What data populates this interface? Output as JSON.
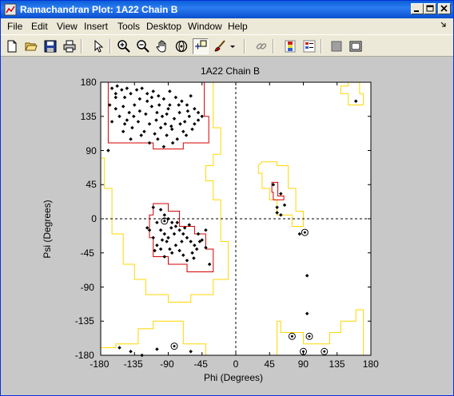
{
  "window": {
    "title": "Ramachandran Plot: 1A22 Chain B"
  },
  "menu": [
    {
      "label": "File"
    },
    {
      "label": "Edit"
    },
    {
      "label": "View"
    },
    {
      "label": "Insert"
    },
    {
      "label": "Tools"
    },
    {
      "label": "Desktop"
    },
    {
      "label": "Window"
    },
    {
      "label": "Help"
    }
  ],
  "toolbar": [
    "new-figure-icon",
    "open-folder-icon",
    "save-icon",
    "print-icon",
    "select-arrow-icon",
    "zoom-in-icon",
    "zoom-out-icon",
    "pan-hand-icon",
    "rotate-3d-icon",
    "data-cursor-icon",
    "brush-icon",
    "link-icon",
    "colorbar-icon",
    "legend-icon",
    "hide-plot-tools-icon",
    "show-plot-tools-icon"
  ],
  "chart_data": {
    "type": "scatter",
    "title": "1A22 Chain B",
    "xlabel": "Phi (Degrees)",
    "ylabel": "Psi (Degrees)",
    "xlim": [
      -180,
      180
    ],
    "ylim": [
      -180,
      180
    ],
    "x_ticks": [
      "-180",
      "-135",
      "-90",
      "-45",
      "0",
      "45",
      "90",
      "135",
      "180"
    ],
    "y_ticks": [
      "180",
      "135",
      "90",
      "45",
      "0",
      "-45",
      "-90",
      "-135",
      "-180"
    ],
    "reference_lines": {
      "phi": 0,
      "psi": 0,
      "style": "dashed"
    },
    "region_colors": {
      "core": "#d40000",
      "allowed": "#ffd700"
    },
    "regions": [
      {
        "name": "core-beta",
        "kind": "core",
        "points": [
          [
            -170,
            180
          ],
          [
            -42,
            180
          ],
          [
            -42,
            135
          ],
          [
            -36,
            135
          ],
          [
            -36,
            100
          ],
          [
            -70,
            100
          ],
          [
            -70,
            92
          ],
          [
            -110,
            92
          ],
          [
            -110,
            100
          ],
          [
            -170,
            100
          ]
        ]
      },
      {
        "name": "core-alpha-right",
        "kind": "core",
        "points": [
          [
            -110,
            20
          ],
          [
            -90,
            20
          ],
          [
            -90,
            10
          ],
          [
            -75,
            10
          ],
          [
            -75,
            -10
          ],
          [
            -55,
            -10
          ],
          [
            -55,
            -20
          ],
          [
            -40,
            -20
          ],
          [
            -40,
            -40
          ],
          [
            -30,
            -40
          ],
          [
            -30,
            -70
          ],
          [
            -65,
            -70
          ],
          [
            -65,
            -60
          ],
          [
            -90,
            -60
          ],
          [
            -90,
            -50
          ],
          [
            -110,
            -50
          ],
          [
            -110,
            -25
          ],
          [
            -115,
            -25
          ],
          [
            -115,
            5
          ],
          [
            -110,
            5
          ]
        ]
      },
      {
        "name": "core-alpha-left",
        "kind": "core",
        "points": [
          [
            48,
            48
          ],
          [
            56,
            48
          ],
          [
            56,
            30
          ],
          [
            64,
            30
          ],
          [
            64,
            25
          ],
          [
            50,
            25
          ],
          [
            50,
            35
          ],
          [
            48,
            35
          ]
        ]
      },
      {
        "name": "allowed-beta",
        "kind": "allowed",
        "points": [
          [
            -180,
            180
          ],
          [
            -30,
            180
          ],
          [
            -30,
            120
          ],
          [
            -20,
            120
          ],
          [
            -20,
            85
          ],
          [
            -30,
            85
          ],
          [
            -30,
            70
          ],
          [
            -40,
            70
          ],
          [
            -40,
            50
          ],
          [
            -30,
            50
          ],
          [
            -30,
            25
          ],
          [
            -20,
            25
          ],
          [
            -20,
            -30
          ],
          [
            -10,
            -30
          ],
          [
            -10,
            -80
          ],
          [
            -30,
            -80
          ],
          [
            -30,
            -100
          ],
          [
            -60,
            -100
          ],
          [
            -60,
            -110
          ],
          [
            -90,
            -110
          ],
          [
            -90,
            -100
          ],
          [
            -120,
            -100
          ],
          [
            -120,
            -80
          ],
          [
            -135,
            -80
          ],
          [
            -135,
            -60
          ],
          [
            -150,
            -60
          ],
          [
            -150,
            -20
          ],
          [
            -165,
            -20
          ],
          [
            -165,
            40
          ],
          [
            -175,
            40
          ],
          [
            -175,
            80
          ],
          [
            -180,
            80
          ]
        ]
      },
      {
        "name": "allowed-alpha-left",
        "kind": "allowed",
        "points": [
          [
            35,
            75
          ],
          [
            55,
            75
          ],
          [
            55,
            70
          ],
          [
            70,
            70
          ],
          [
            70,
            40
          ],
          [
            80,
            40
          ],
          [
            80,
            10
          ],
          [
            90,
            10
          ],
          [
            90,
            -10
          ],
          [
            75,
            -10
          ],
          [
            75,
            5
          ],
          [
            55,
            5
          ],
          [
            55,
            25
          ],
          [
            45,
            25
          ],
          [
            45,
            40
          ],
          [
            35,
            40
          ],
          [
            35,
            60
          ],
          [
            30,
            60
          ],
          [
            30,
            70
          ]
        ]
      },
      {
        "name": "allowed-gamma-bottom",
        "kind": "allowed",
        "points": [
          [
            20,
            -180
          ],
          [
            170,
            -180
          ],
          [
            170,
            -120
          ],
          [
            160,
            -120
          ],
          [
            160,
            -135
          ],
          [
            140,
            -135
          ],
          [
            140,
            -150
          ],
          [
            125,
            -150
          ],
          [
            125,
            -165
          ],
          [
            90,
            -165
          ],
          [
            90,
            -150
          ],
          [
            60,
            -150
          ],
          [
            60,
            -135
          ],
          [
            55,
            -135
          ],
          [
            55,
            -180
          ]
        ]
      },
      {
        "name": "allowed-beta-bottom",
        "kind": "allowed",
        "points": [
          [
            -180,
            -180
          ],
          [
            -40,
            -180
          ],
          [
            -40,
            -165
          ],
          [
            -70,
            -165
          ],
          [
            -70,
            -135
          ],
          [
            -110,
            -135
          ],
          [
            -110,
            -145
          ],
          [
            -130,
            -145
          ],
          [
            -130,
            -165
          ],
          [
            -160,
            -165
          ],
          [
            -160,
            -170
          ],
          [
            -180,
            -170
          ]
        ]
      },
      {
        "name": "allowed-top-right",
        "kind": "allowed",
        "points": [
          [
            150,
            180
          ],
          [
            165,
            180
          ],
          [
            165,
            165
          ],
          [
            170,
            165
          ],
          [
            170,
            150
          ],
          [
            150,
            150
          ],
          [
            150,
            165
          ],
          [
            140,
            165
          ],
          [
            140,
            175
          ],
          [
            150,
            175
          ]
        ]
      }
    ],
    "series": [
      {
        "marker": "dot",
        "points": [
          [
            -165,
            172
          ],
          [
            -158,
            175
          ],
          [
            -152,
            170
          ],
          [
            -160,
            160
          ],
          [
            -148,
            160
          ],
          [
            -140,
            165
          ],
          [
            -132,
            170
          ],
          [
            -125,
            172
          ],
          [
            -118,
            165
          ],
          [
            -110,
            168
          ],
          [
            -103,
            162
          ],
          [
            -96,
            158
          ],
          [
            -88,
            168
          ],
          [
            -80,
            160
          ],
          [
            -72,
            155
          ],
          [
            -65,
            150
          ],
          [
            -60,
            162
          ],
          [
            -55,
            145
          ],
          [
            -50,
            140
          ],
          [
            -45,
            135
          ],
          [
            -168,
            150
          ],
          [
            -160,
            145
          ],
          [
            -150,
            148
          ],
          [
            -142,
            140
          ],
          [
            -135,
            150
          ],
          [
            -128,
            142
          ],
          [
            -120,
            138
          ],
          [
            -112,
            148
          ],
          [
            -105,
            140
          ],
          [
            -98,
            135
          ],
          [
            -90,
            145
          ],
          [
            -82,
            132
          ],
          [
            -75,
            140
          ],
          [
            -68,
            128
          ],
          [
            -62,
            135
          ],
          [
            -55,
            125
          ],
          [
            -145,
            130
          ],
          [
            -138,
            120
          ],
          [
            -130,
            128
          ],
          [
            -122,
            115
          ],
          [
            -115,
            125
          ],
          [
            -108,
            112
          ],
          [
            -100,
            120
          ],
          [
            -92,
            110
          ],
          [
            -85,
            118
          ],
          [
            -78,
            105
          ],
          [
            -70,
            115
          ],
          [
            -150,
            115
          ],
          [
            -140,
            105
          ],
          [
            -126,
            110
          ],
          [
            -115,
            100
          ],
          [
            -104,
            105
          ],
          [
            -96,
            95
          ],
          [
            -84,
            100
          ],
          [
            -165,
            128
          ],
          [
            -155,
            135
          ],
          [
            -148,
            125
          ],
          [
            -136,
            135
          ],
          [
            -118,
            155
          ],
          [
            -102,
            150
          ],
          [
            -94,
            125
          ],
          [
            -88,
            150
          ],
          [
            -76,
            150
          ],
          [
            -64,
            142
          ],
          [
            -58,
            118
          ],
          [
            -50,
            130
          ],
          [
            -170,
            90
          ],
          [
            -160,
            165
          ],
          [
            -145,
            172
          ],
          [
            -128,
            158
          ],
          [
            -112,
            160
          ],
          [
            -106,
            130
          ],
          [
            -92,
            138
          ],
          [
            -86,
            122
          ],
          [
            -74,
            125
          ],
          [
            -66,
            110
          ],
          [
            -110,
            15
          ],
          [
            -100,
            12
          ],
          [
            -95,
            5
          ],
          [
            -90,
            0
          ],
          [
            -85,
            -5
          ],
          [
            -80,
            -10
          ],
          [
            -75,
            -15
          ],
          [
            -70,
            -20
          ],
          [
            -65,
            -25
          ],
          [
            -60,
            -30
          ],
          [
            -55,
            -35
          ],
          [
            -50,
            -20
          ],
          [
            -45,
            -28
          ],
          [
            -40,
            -38
          ],
          [
            -105,
            -5
          ],
          [
            -100,
            -15
          ],
          [
            -95,
            -20
          ],
          [
            -92,
            -30
          ],
          [
            -88,
            -40
          ],
          [
            -85,
            -45
          ],
          [
            -80,
            -35
          ],
          [
            -75,
            -42
          ],
          [
            -70,
            -48
          ],
          [
            -65,
            -55
          ],
          [
            -58,
            -45
          ],
          [
            -52,
            -40
          ],
          [
            -48,
            -30
          ],
          [
            -115,
            -15
          ],
          [
            -110,
            -25
          ],
          [
            -105,
            -35
          ],
          [
            -100,
            -40
          ],
          [
            -95,
            -50
          ],
          [
            -90,
            -25
          ],
          [
            -82,
            -20
          ],
          [
            -78,
            -5
          ],
          [
            -72,
            -30
          ],
          [
            -68,
            -12
          ],
          [
            -62,
            -8
          ],
          [
            -56,
            -52
          ],
          [
            -40,
            -15
          ],
          [
            -35,
            -60
          ],
          [
            -108,
            -42
          ],
          [
            -98,
            -28
          ],
          [
            -86,
            -12
          ],
          [
            -118,
            -12
          ],
          [
            50,
            45
          ],
          [
            60,
            33
          ],
          [
            55,
            15
          ],
          [
            65,
            18
          ],
          [
            55,
            8
          ],
          [
            60,
            5
          ],
          [
            95,
            -75
          ],
          [
            85,
            -20
          ],
          [
            95,
            -125
          ],
          [
            160,
            155
          ],
          [
            -155,
            -170
          ],
          [
            -140,
            -175
          ],
          [
            -125,
            -180
          ],
          [
            -60,
            -175
          ],
          [
            -105,
            -172
          ]
        ]
      },
      {
        "marker": "ring",
        "points": [
          [
            -95,
            -3
          ],
          [
            92,
            -18
          ],
          [
            -82,
            -168
          ],
          [
            75,
            -155
          ],
          [
            98,
            -155
          ],
          [
            90,
            -175
          ],
          [
            118,
            -175
          ]
        ]
      }
    ]
  }
}
